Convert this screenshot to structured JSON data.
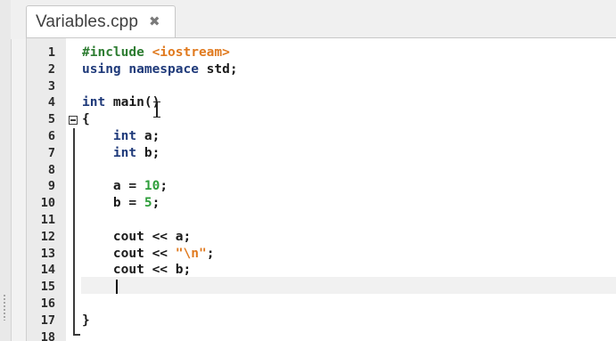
{
  "tab": {
    "filename": "Variables.cpp",
    "close_glyph": "✖"
  },
  "editor": {
    "line_numbers": [
      "1",
      "2",
      "3",
      "4",
      "5",
      "6",
      "7",
      "8",
      "9",
      "10",
      "11",
      "12",
      "13",
      "14",
      "15",
      "16",
      "17",
      "18"
    ],
    "lines": [
      [
        {
          "t": "#include ",
          "c": "pp"
        },
        {
          "t": "<iostream>",
          "c": "inc"
        }
      ],
      [
        {
          "t": "using namespace",
          "c": "kw"
        },
        {
          "t": " std;",
          "c": ""
        }
      ],
      [],
      [
        {
          "t": "int",
          "c": "kw"
        },
        {
          "t": " main()",
          "c": ""
        }
      ],
      [
        {
          "t": "{",
          "c": ""
        }
      ],
      [
        {
          "t": "    ",
          "c": ""
        },
        {
          "t": "int",
          "c": "kw"
        },
        {
          "t": " a;",
          "c": ""
        }
      ],
      [
        {
          "t": "    ",
          "c": ""
        },
        {
          "t": "int",
          "c": "kw"
        },
        {
          "t": " b;",
          "c": ""
        }
      ],
      [],
      [
        {
          "t": "    a = ",
          "c": ""
        },
        {
          "t": "10",
          "c": "num"
        },
        {
          "t": ";",
          "c": ""
        }
      ],
      [
        {
          "t": "    b = ",
          "c": ""
        },
        {
          "t": "5",
          "c": "num"
        },
        {
          "t": ";",
          "c": ""
        }
      ],
      [],
      [
        {
          "t": "    cout << a;",
          "c": ""
        }
      ],
      [
        {
          "t": "    cout << ",
          "c": ""
        },
        {
          "t": "\"\\n\"",
          "c": "str"
        },
        {
          "t": ";",
          "c": ""
        }
      ],
      [
        {
          "t": "    cout << b;",
          "c": ""
        }
      ],
      [],
      [],
      [
        {
          "t": "}",
          "c": ""
        }
      ],
      []
    ]
  },
  "colors": {
    "keyword": "#1f3a7a",
    "preprocessor": "#2e7d32",
    "include_path": "#e07a1f",
    "number": "#2e9e3a",
    "string": "#e07a1f"
  }
}
